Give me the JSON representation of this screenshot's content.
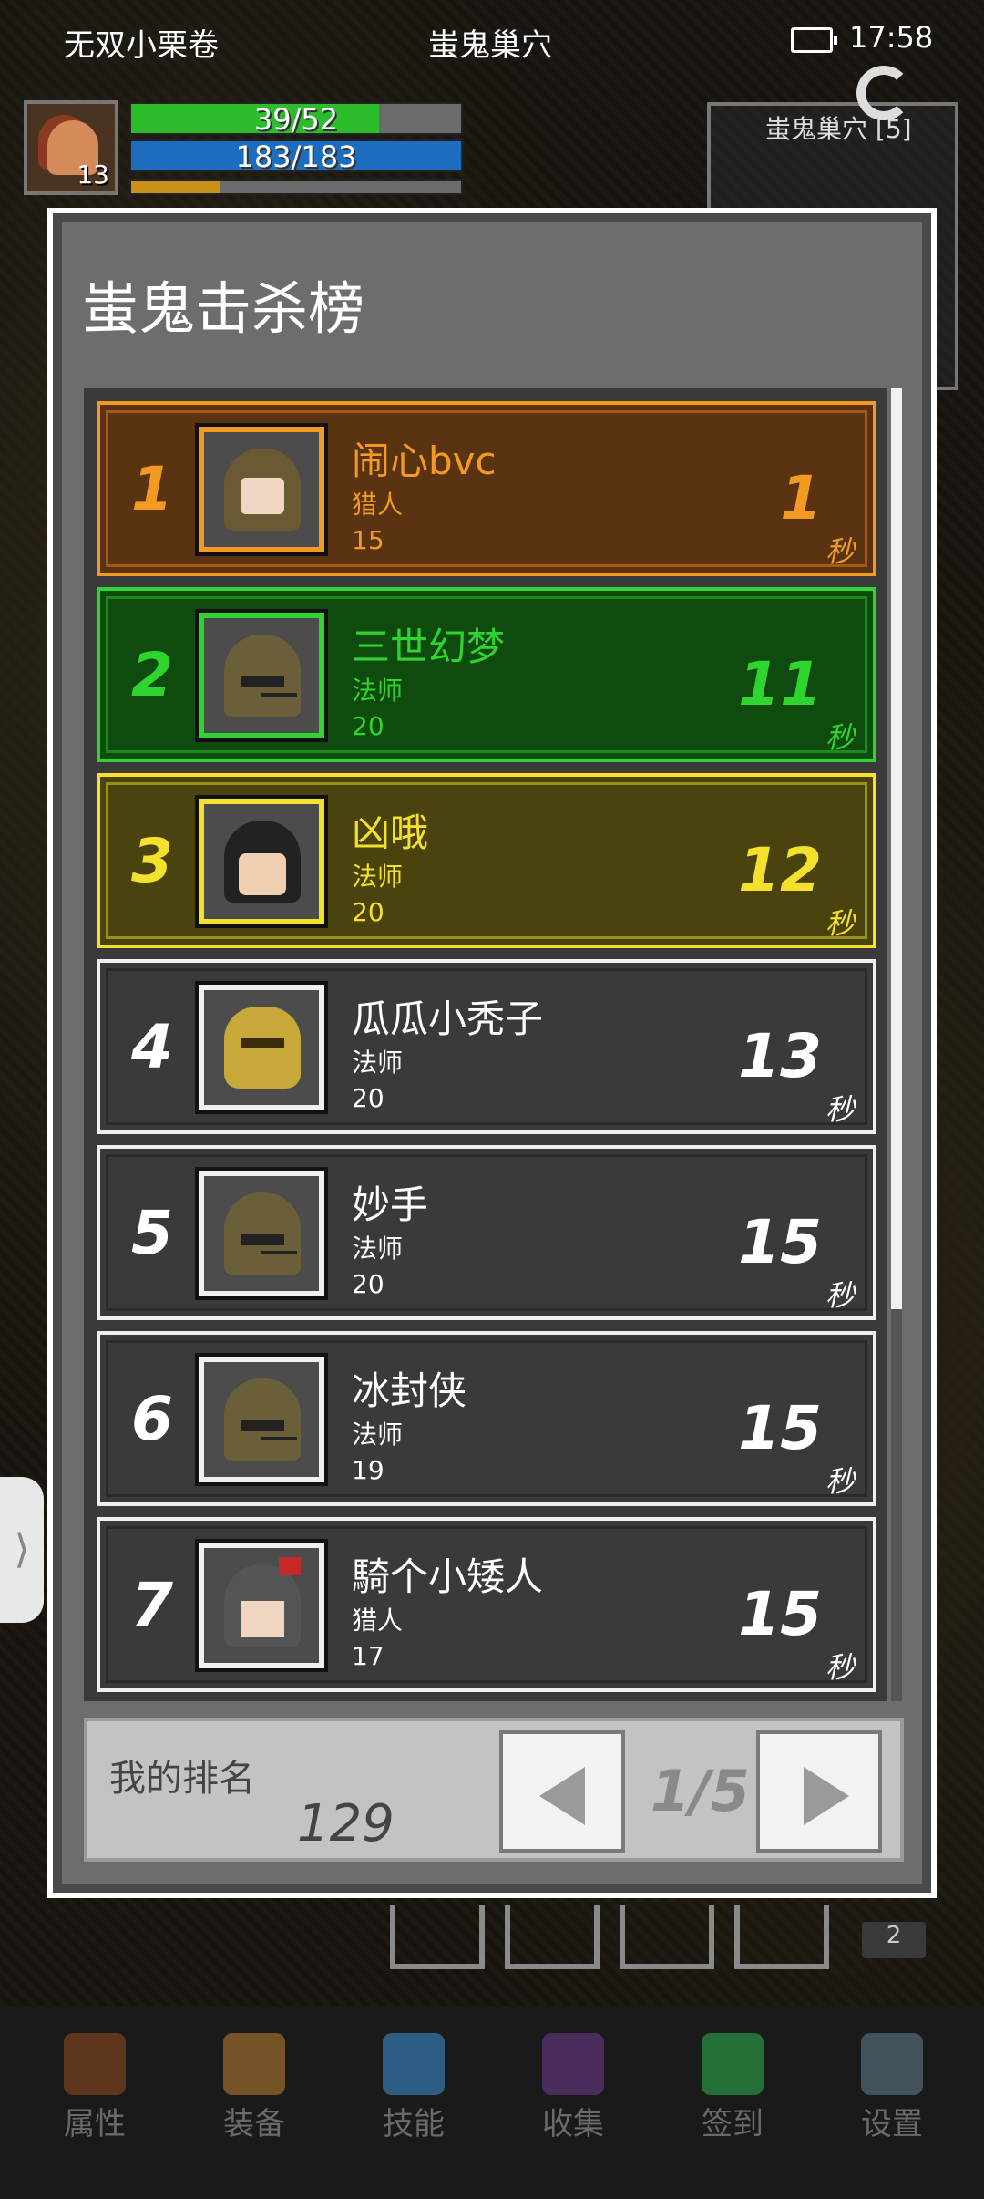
{
  "status_bar": {
    "app_name": "无双小栗卷",
    "location": "蚩鬼巢穴",
    "time": "17:58"
  },
  "player": {
    "level": "13",
    "hp_text": "39/52",
    "hp_fill": 0.75,
    "mp_text": "183/183",
    "mp_fill": 1.0,
    "xp_fill": 0.27
  },
  "minimap": {
    "title": "蚩鬼巢穴 [5]"
  },
  "side_handle": {
    "glyph": "⟩"
  },
  "leaderboard": {
    "title": "蚩鬼击杀榜",
    "unit": "秒",
    "rows": [
      {
        "rank": "1",
        "name": "闹心bvc",
        "class": "猎人",
        "level": "15",
        "time": "1",
        "style": "gold",
        "sprite": "hooded-hunter"
      },
      {
        "rank": "2",
        "name": "三世幻梦",
        "class": "法师",
        "level": "20",
        "time": "11",
        "style": "green",
        "sprite": "iron-helmet"
      },
      {
        "rank": "3",
        "name": "凶哦",
        "class": "法师",
        "level": "20",
        "time": "12",
        "style": "yellow",
        "sprite": "black-hair"
      },
      {
        "rank": "4",
        "name": "瓜瓜小秃子",
        "class": "法师",
        "level": "20",
        "time": "13",
        "style": "plain",
        "sprite": "gold-skull"
      },
      {
        "rank": "5",
        "name": "妙手",
        "class": "法师",
        "level": "20",
        "time": "15",
        "style": "plain",
        "sprite": "iron-helmet"
      },
      {
        "rank": "6",
        "name": "冰封侠",
        "class": "法师",
        "level": "19",
        "time": "15",
        "style": "plain",
        "sprite": "iron-helmet"
      },
      {
        "rank": "7",
        "name": "騎个小矮人",
        "class": "猎人",
        "level": "17",
        "time": "15",
        "style": "plain",
        "sprite": "knight-helmet"
      }
    ],
    "my_rank_label": "我的排名",
    "my_rank_value": "129",
    "page_indicator": "1/5"
  },
  "bag_count": "2",
  "bottom_nav": [
    {
      "label": "属性",
      "icon": "helmet-icon",
      "color": "#8a4a20"
    },
    {
      "label": "装备",
      "icon": "bag-icon",
      "color": "#b07a30"
    },
    {
      "label": "技能",
      "icon": "skill-orb-icon",
      "color": "#3a8ac8"
    },
    {
      "label": "收集",
      "icon": "book-icon",
      "color": "#6a3a8a"
    },
    {
      "label": "签到",
      "icon": "gem-icon",
      "color": "#2aa84a"
    },
    {
      "label": "设置",
      "icon": "gear-icon",
      "color": "#5a7a8a"
    }
  ]
}
